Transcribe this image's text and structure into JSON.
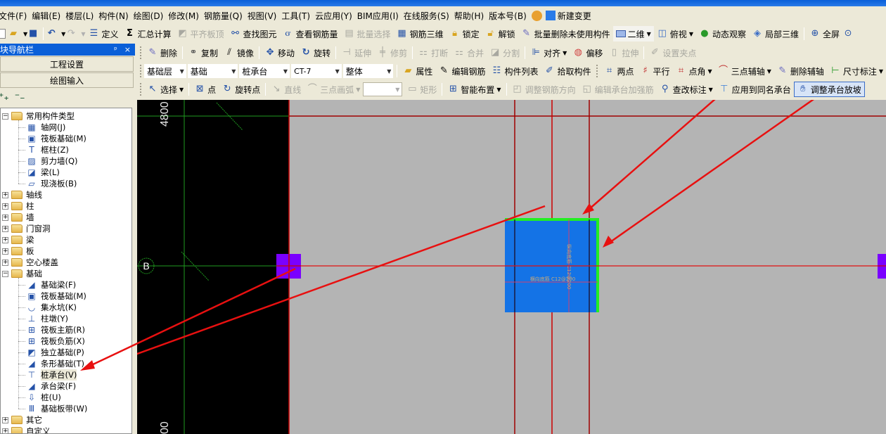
{
  "menubar": {
    "items": [
      "文件(F)",
      "编辑(E)",
      "楼层(L)",
      "构件(N)",
      "绘图(D)",
      "修改(M)",
      "钢筋量(Q)",
      "视图(V)",
      "工具(T)",
      "云应用(Y)",
      "BIM应用(I)",
      "在线服务(S)",
      "帮助(H)",
      "版本号(B)"
    ],
    "new_change": "新建变更"
  },
  "toolbar1": {
    "define": "定义",
    "summary_calc": "汇总计算",
    "align_slab_top": "平齐板顶",
    "find_element": "查找图元",
    "view_rebar": "查看钢筋量",
    "batch_select": "批量选择",
    "rebar_3d": "钢筋三维",
    "lock": "锁定",
    "unlock": "解锁",
    "batch_delete_unused": "批量删除未使用构件",
    "view_mode": "二维",
    "view_dir": "俯视",
    "dynamic_observe": "动态观察",
    "local_3d": "局部三维",
    "fullscreen": "全屏"
  },
  "sidebar": {
    "title": "模块导航栏",
    "pin": "ㅁ",
    "close": "×",
    "project_settings": "工程设置",
    "drawing_input": "绘图输入",
    "expand_all": "+",
    "collapse_all": "−",
    "tree": [
      {
        "label": "常用构件类型",
        "type": "folder",
        "expanded": true,
        "children": [
          "轴网(J)",
          "筏板基础(M)",
          "框柱(Z)",
          "剪力墙(Q)",
          "梁(L)",
          "现浇板(B)"
        ]
      },
      {
        "label": "轴线",
        "type": "folder",
        "expanded": false
      },
      {
        "label": "柱",
        "type": "folder",
        "expanded": false
      },
      {
        "label": "墙",
        "type": "folder",
        "expanded": false
      },
      {
        "label": "门窗洞",
        "type": "folder",
        "expanded": false
      },
      {
        "label": "梁",
        "type": "folder",
        "expanded": false
      },
      {
        "label": "板",
        "type": "folder",
        "expanded": false
      },
      {
        "label": "空心楼盖",
        "type": "folder",
        "expanded": false
      },
      {
        "label": "基础",
        "type": "folder",
        "expanded": true,
        "children": [
          "基础梁(F)",
          "筏板基础(M)",
          "集水坑(K)",
          "柱墩(Y)",
          "筏板主筋(R)",
          "筏板负筋(X)",
          "独立基础(P)",
          "条形基础(T)",
          "桩承台(V)",
          "承台梁(F)",
          "桩(U)",
          "基础板带(W)"
        ]
      },
      {
        "label": "其它",
        "type": "folder",
        "expanded": false
      },
      {
        "label": "自定义",
        "type": "folder",
        "expanded": false
      }
    ],
    "selected": "桩承台(V)"
  },
  "toolbar_modify": {
    "delete": "删除",
    "copy": "复制",
    "mirror": "镜像",
    "move": "移动",
    "rotate": "旋转",
    "extend": "延伸",
    "trim": "修剪",
    "break": "打断",
    "merge": "合并",
    "split": "分割",
    "align": "对齐",
    "offset": "偏移",
    "stretch": "拉伸",
    "set_grip": "设置夹点"
  },
  "toolbar_selectors": {
    "floor": "基础层",
    "category": "基础",
    "type": "桩承台",
    "name": "CT-7",
    "scope": "整体",
    "properties": "属性",
    "edit_rebar": "编辑钢筋",
    "element_list": "构件列表",
    "pick_element": "拾取构件",
    "two_points": "两点",
    "parallel": "平行",
    "point_angle": "点角",
    "three_point_axis": "三点辅轴",
    "delete_axis": "删除辅轴",
    "dimension": "尺寸标注"
  },
  "toolbar_draw": {
    "select": "选择",
    "point": "点",
    "rotate_point": "旋转点",
    "line": "直线",
    "arc": "三点画弧",
    "arc_value": "",
    "rect": "矩形",
    "smart_layout": "智能布置",
    "adjust_rebar_dir": "调整钢筋方向",
    "edit_cap_rebar": "编辑承台加强筋",
    "edit_label": "查改标注",
    "apply_same_name": "应用到同名承台",
    "adjust_slope": "调整承台放坡"
  },
  "canvas": {
    "axis_label_top": "4800",
    "axis_label_bottom": "00",
    "axis_bubble": "B",
    "cap_text_h": "横向底筋 C12@200",
    "cap_text_v": "纵向底筋 C12@200",
    "colors": {
      "background": "#b4b4b4",
      "black_area": "#000000",
      "cap_fill": "#1473e6",
      "cap_edge": "#22ee22",
      "column_fill": "#7a00ff",
      "grid_red": "#cc0000",
      "axis_green": "#1f9a1f",
      "annotation_arrow": "#e81010"
    }
  }
}
